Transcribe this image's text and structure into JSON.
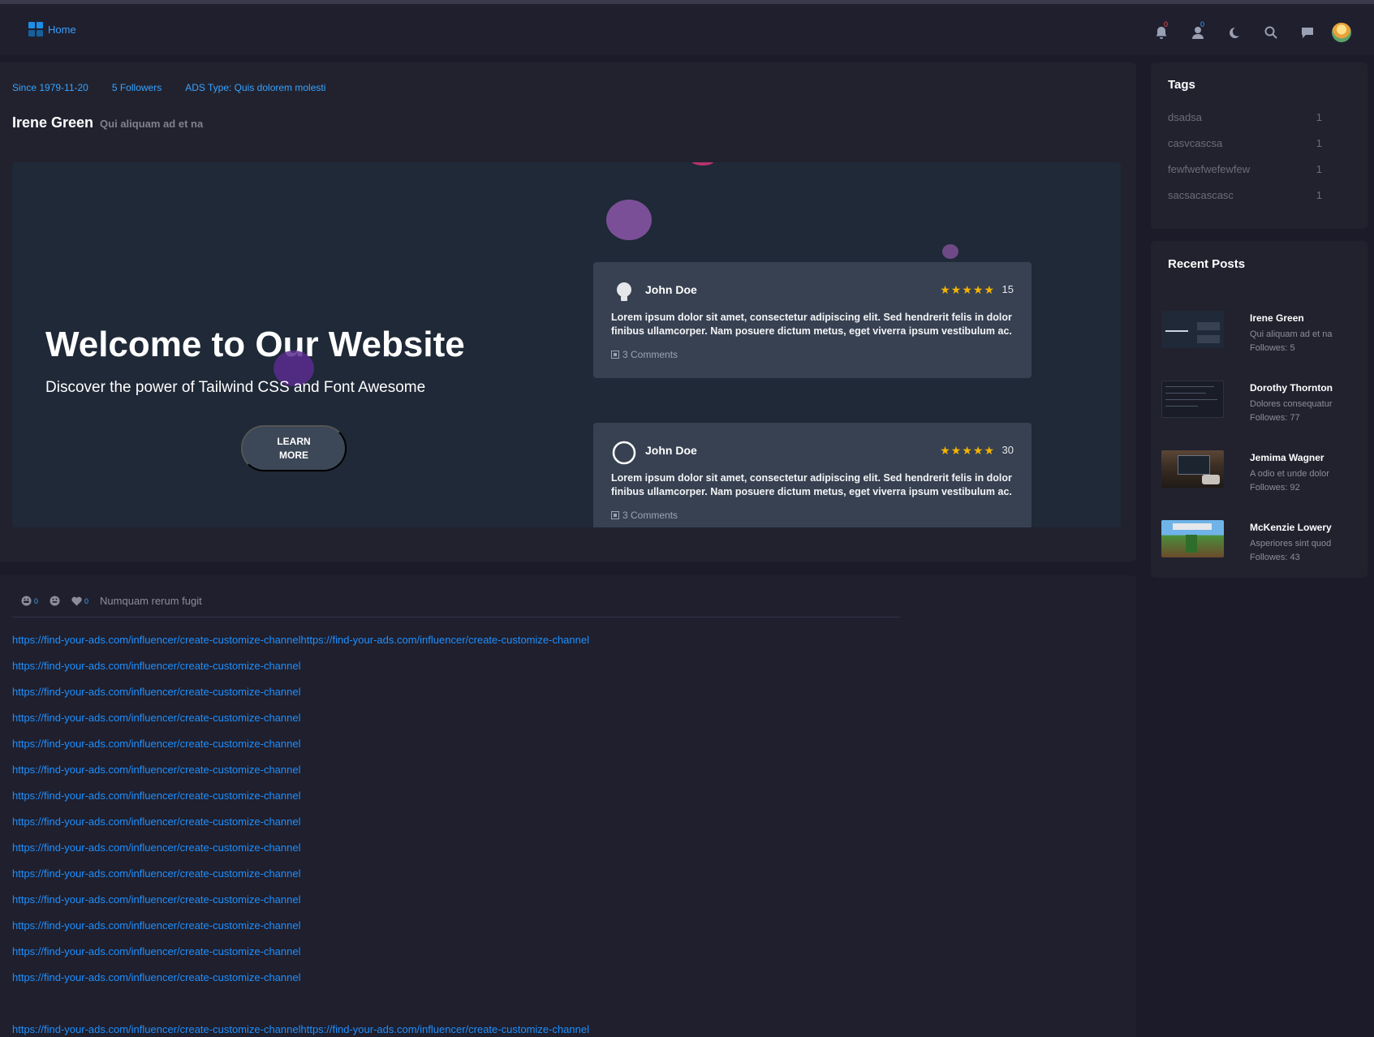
{
  "nav": {
    "home_label": "Home",
    "notifications_count": "0",
    "friends_count": "0"
  },
  "profile": {
    "since": "Since 1979-11-20",
    "followers": "5 Followers",
    "ads_type": "ADS Type: Quis dolorem molesti",
    "name": "Irene Green",
    "subtitle": "Qui aliquam ad et na"
  },
  "hero": {
    "title": "Welcome to Our Website",
    "subtitle": "Discover the power of Tailwind CSS and Font Awesome",
    "button_label": "LEARN MORE",
    "reviews": [
      {
        "name": "John Doe",
        "stars": "★★★★★",
        "count": "15",
        "text": "Lorem ipsum dolor sit amet, consectetur adipiscing elit. Sed hendrerit felis in dolor finibus ullamcorper. Nam posuere dictum metus, eget viverra ipsum vestibulum ac.",
        "comments": "3 Comments"
      },
      {
        "name": "John Doe",
        "stars": "★★★★★",
        "count": "30",
        "text": "Lorem ipsum dolor sit amet, consectetur adipiscing elit. Sed hendrerit felis in dolor finibus ullamcorper. Nam posuere dictum metus, eget viverra ipsum vestibulum ac.",
        "comments": "3 Comments"
      }
    ]
  },
  "reactions": {
    "laugh_count": "0",
    "heart_count": "0",
    "caption": "Numquam rerum fugit"
  },
  "links": [
    "https://find-your-ads.com/influencer/create-customize-channelhttps://find-your-ads.com/influencer/create-customize-channel",
    "https://find-your-ads.com/influencer/create-customize-channel",
    "https://find-your-ads.com/influencer/create-customize-channel",
    "https://find-your-ads.com/influencer/create-customize-channel",
    "https://find-your-ads.com/influencer/create-customize-channel",
    "https://find-your-ads.com/influencer/create-customize-channel",
    "https://find-your-ads.com/influencer/create-customize-channel",
    "https://find-your-ads.com/influencer/create-customize-channel",
    "https://find-your-ads.com/influencer/create-customize-channel",
    "https://find-your-ads.com/influencer/create-customize-channel",
    "https://find-your-ads.com/influencer/create-customize-channel",
    "https://find-your-ads.com/influencer/create-customize-channel",
    "https://find-your-ads.com/influencer/create-customize-channel",
    "https://find-your-ads.com/influencer/create-customize-channel",
    "https://find-your-ads.com/influencer/create-customize-channelhttps://find-your-ads.com/influencer/create-customize-channel"
  ],
  "tags": {
    "title": "Tags",
    "items": [
      {
        "name": "dsadsa",
        "count": "1"
      },
      {
        "name": "casvcascsa",
        "count": "1"
      },
      {
        "name": "fewfwefwefewfew",
        "count": "1"
      },
      {
        "name": "sacsacascasc",
        "count": "1"
      }
    ]
  },
  "recent_posts": {
    "title": "Recent Posts",
    "items": [
      {
        "name": "Irene Green",
        "desc": "Qui aliquam ad et na",
        "followers": "Followes: 5"
      },
      {
        "name": "Dorothy Thornton",
        "desc": "Dolores consequatur",
        "followers": "Followes: 77"
      },
      {
        "name": "Jemima Wagner",
        "desc": "A odio et unde dolor",
        "followers": "Followes: 92"
      },
      {
        "name": "McKenzie Lowery",
        "desc": "Asperiores sint quod",
        "followers": "Followes: 43"
      }
    ]
  },
  "colors": {
    "accent": "#1e90ff",
    "background": "#1b1b2a",
    "card": "#22222f",
    "star": "#f5b400"
  }
}
